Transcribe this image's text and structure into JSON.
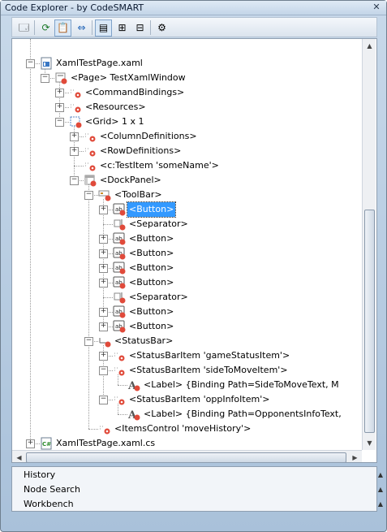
{
  "window": {
    "title": "Code Explorer - by CodeSMART"
  },
  "toolbar": {
    "buttons": [
      "new",
      "refresh",
      "paste",
      "sync",
      "properties",
      "expand-all",
      "collapse-all",
      "settings"
    ]
  },
  "tree": {
    "nodes": [
      {
        "label": "XamlTestPage.xaml",
        "icon": "xaml-file-icon",
        "expander": "-"
      },
      {
        "label": "<Page> TestXamlWindow",
        "icon": "page-icon",
        "expander": "-"
      },
      {
        "label": "<CommandBindings>",
        "icon": "element-icon",
        "expander": "+"
      },
      {
        "label": "<Resources>",
        "icon": "element-icon",
        "expander": "+"
      },
      {
        "label": "<Grid> 1 x 1",
        "icon": "grid-icon",
        "expander": "-"
      },
      {
        "label": "<ColumnDefinitions>",
        "icon": "element-icon",
        "expander": "+"
      },
      {
        "label": "<RowDefinitions>",
        "icon": "element-icon",
        "expander": "+"
      },
      {
        "label": "<c:TestItem  'someName'>",
        "icon": "element-icon",
        "expander": ""
      },
      {
        "label": "<DockPanel>",
        "icon": "dockpanel-icon",
        "expander": "-"
      },
      {
        "label": "<ToolBar>",
        "icon": "toolbar-icon",
        "expander": "-"
      },
      {
        "label": "<Button>",
        "icon": "button-icon",
        "expander": "+",
        "selected": true
      },
      {
        "label": "<Separator>",
        "icon": "separator-icon",
        "expander": ""
      },
      {
        "label": "<Button>",
        "icon": "button-icon",
        "expander": "+"
      },
      {
        "label": "<Button>",
        "icon": "button-icon",
        "expander": "+"
      },
      {
        "label": "<Button>",
        "icon": "button-icon",
        "expander": "+"
      },
      {
        "label": "<Button>",
        "icon": "button-icon",
        "expander": "+"
      },
      {
        "label": "<Separator>",
        "icon": "separator-icon",
        "expander": ""
      },
      {
        "label": "<Button>",
        "icon": "button-icon",
        "expander": "+"
      },
      {
        "label": "<Button>",
        "icon": "button-icon",
        "expander": "+"
      },
      {
        "label": "<StatusBar>",
        "icon": "statusbar-icon",
        "expander": "-"
      },
      {
        "label": "<StatusBarItem  'gameStatusItem'>",
        "icon": "element-icon",
        "expander": "+"
      },
      {
        "label": "<StatusBarItem  'sideToMoveItem'>",
        "icon": "element-icon",
        "expander": "-"
      },
      {
        "label": "<Label> {Binding Path=SideToMoveText, M",
        "icon": "label-icon",
        "expander": ""
      },
      {
        "label": "<StatusBarItem  'oppInfoItem'>",
        "icon": "element-icon",
        "expander": "-"
      },
      {
        "label": "<Label> {Binding Path=OpponentsInfoText,",
        "icon": "label-icon",
        "expander": ""
      },
      {
        "label": "<ItemsControl  'moveHistory'>",
        "icon": "element-icon",
        "expander": ""
      },
      {
        "label": "XamlTestPage.xaml.cs",
        "icon": "cs-file-icon",
        "expander": "+"
      }
    ]
  },
  "panels": [
    {
      "label": "History"
    },
    {
      "label": "Node Search"
    },
    {
      "label": "Workbench"
    }
  ],
  "colors": {
    "selection": "#3399ff",
    "accent": "#d9e8f7"
  }
}
